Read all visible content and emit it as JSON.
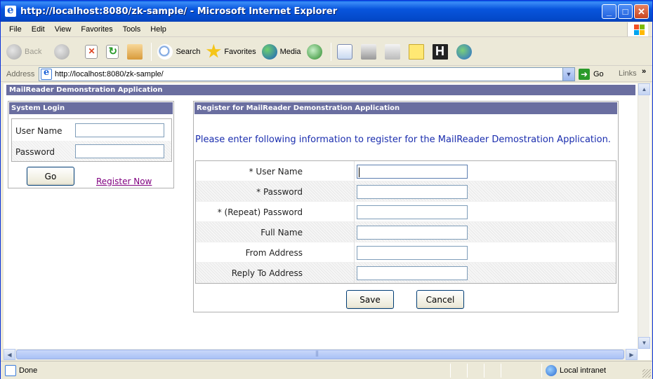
{
  "window": {
    "title": "http://localhost:8080/zk-sample/ - Microsoft Internet Explorer",
    "min_glyph": "_",
    "max_glyph": "□",
    "close_glyph": "✕"
  },
  "menu": [
    "File",
    "Edit",
    "View",
    "Favorites",
    "Tools",
    "Help"
  ],
  "toolbar": {
    "back_label": "Back",
    "search_label": "Search",
    "favorites_label": "Favorites",
    "media_label": "Media",
    "hotlist_glyph": "H"
  },
  "address": {
    "label": "Address",
    "url": "http://localhost:8080/zk-sample/",
    "go_label": "Go",
    "links_label": "Links",
    "links_chevron": "»"
  },
  "page": {
    "app_title": "MailReader Demonstration Application",
    "login": {
      "title": "System Login",
      "username_label": "User Name",
      "password_label": "Password",
      "username_value": "",
      "password_value": "",
      "go_label": "Go",
      "register_link": "Register Now"
    },
    "register": {
      "title": "Register for MailReader Demonstration Application",
      "intro": "Please enter following information to register for the MailReader Demostration Application.",
      "fields": [
        {
          "label": "* User Name",
          "value": ""
        },
        {
          "label": "* Password",
          "value": ""
        },
        {
          "label": "* (Repeat) Password",
          "value": ""
        },
        {
          "label": "Full Name",
          "value": ""
        },
        {
          "label": "From Address",
          "value": ""
        },
        {
          "label": "Reply To Address",
          "value": ""
        }
      ],
      "save_label": "Save",
      "cancel_label": "Cancel"
    }
  },
  "status": {
    "text": "Done",
    "zone": "Local intranet"
  },
  "icons": {
    "scroll_up": "▲",
    "scroll_down": "▼",
    "scroll_left": "◀",
    "scroll_right": "▶",
    "go_arrow": "➜",
    "dropdown": "▼"
  }
}
